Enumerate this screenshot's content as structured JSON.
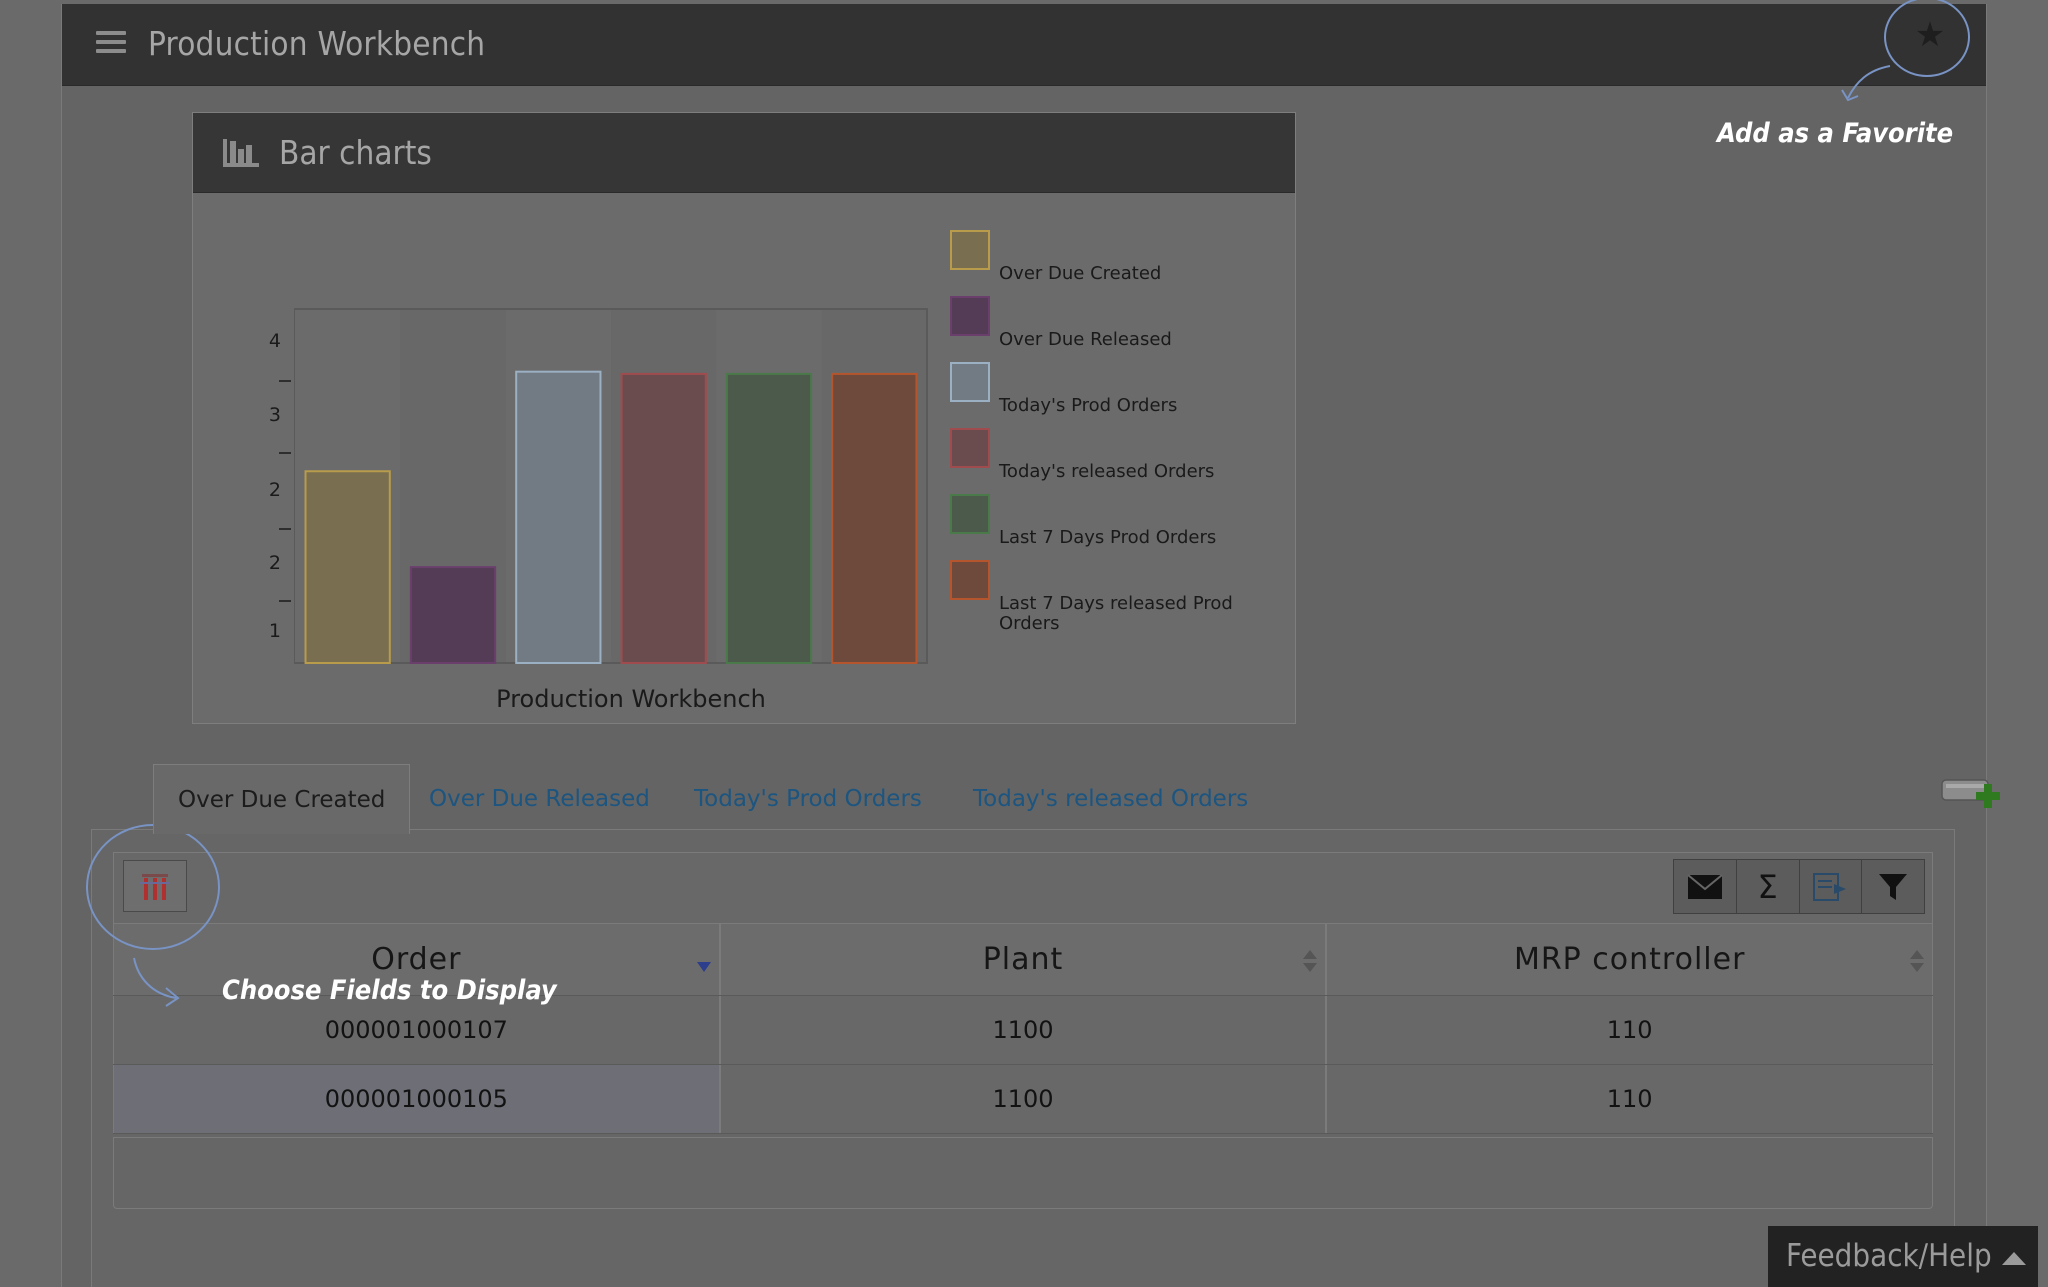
{
  "header": {
    "title": "Production Workbench",
    "menu_icon": "hamburger-icon",
    "favorite_icon": "star-icon"
  },
  "callouts": {
    "favorite": "Add as a Favorite",
    "fields": "Choose Fields to Display"
  },
  "chart_panel": {
    "title": "Bar charts",
    "icon": "bar-chart-icon"
  },
  "chart_data": {
    "type": "bar",
    "title": "",
    "xlabel": "Production Workbench",
    "ylabel": "",
    "categories": [
      "Over Due Created",
      "Over Due Released",
      "Today's Prod Orders",
      "Today's released Orders",
      "Last 7 Days Prod Orders",
      "Last 7 Days released Prod Orders"
    ],
    "values": [
      2.6,
      1.3,
      3.95,
      3.92,
      3.92,
      3.92
    ],
    "ylim": [
      0,
      4.8
    ],
    "yticks": [
      {
        "value": 1,
        "label": "1"
      },
      {
        "value": 1.5,
        "label": ""
      },
      {
        "value": 2,
        "label": "2"
      },
      {
        "value": 2.5,
        "label": ""
      },
      {
        "value": 3,
        "label": "2"
      },
      {
        "value": 3.5,
        "label": ""
      },
      {
        "value": 4,
        "label": "3"
      },
      {
        "value": 4.5,
        "label": ""
      },
      {
        "value": 5,
        "label": "4"
      }
    ],
    "colors": [
      "#796e4f",
      "#553c56",
      "#727b83",
      "#6b4c4e",
      "#4b5a4b",
      "#6e4a3c"
    ],
    "borders": [
      "#b89c4c",
      "#6a3f6c",
      "#9cb0c4",
      "#a04c4e",
      "#4a7a4a",
      "#b5552e"
    ],
    "legend": [
      "Over Due Created",
      "Over Due Released",
      "Today's Prod Orders",
      "Today's released Orders",
      "Last 7 Days Prod Orders",
      "Last 7 Days released Prod",
      "Orders"
    ],
    "legend_position": "right",
    "grid": true
  },
  "tabs": [
    {
      "label": "Over Due Created",
      "active": true
    },
    {
      "label": "Over Due Released",
      "active": false
    },
    {
      "label": "Today's Prod Orders",
      "active": false
    },
    {
      "label": "Today's released Orders",
      "active": false
    }
  ],
  "toolbar": {
    "fields_icon": "column-chooser-icon",
    "add_layout_icon": "add-layout-icon",
    "tools": [
      "envelope-icon",
      "sum-icon",
      "export-icon",
      "filter-icon"
    ]
  },
  "table": {
    "columns": [
      "Order",
      "Plant",
      "MRP controller"
    ],
    "rows": [
      [
        "000001000107",
        "1100",
        "110"
      ],
      [
        "000001000105",
        "1100",
        "110"
      ]
    ],
    "selected_row": 1
  },
  "feedback": {
    "label": "Feedback/Help"
  }
}
